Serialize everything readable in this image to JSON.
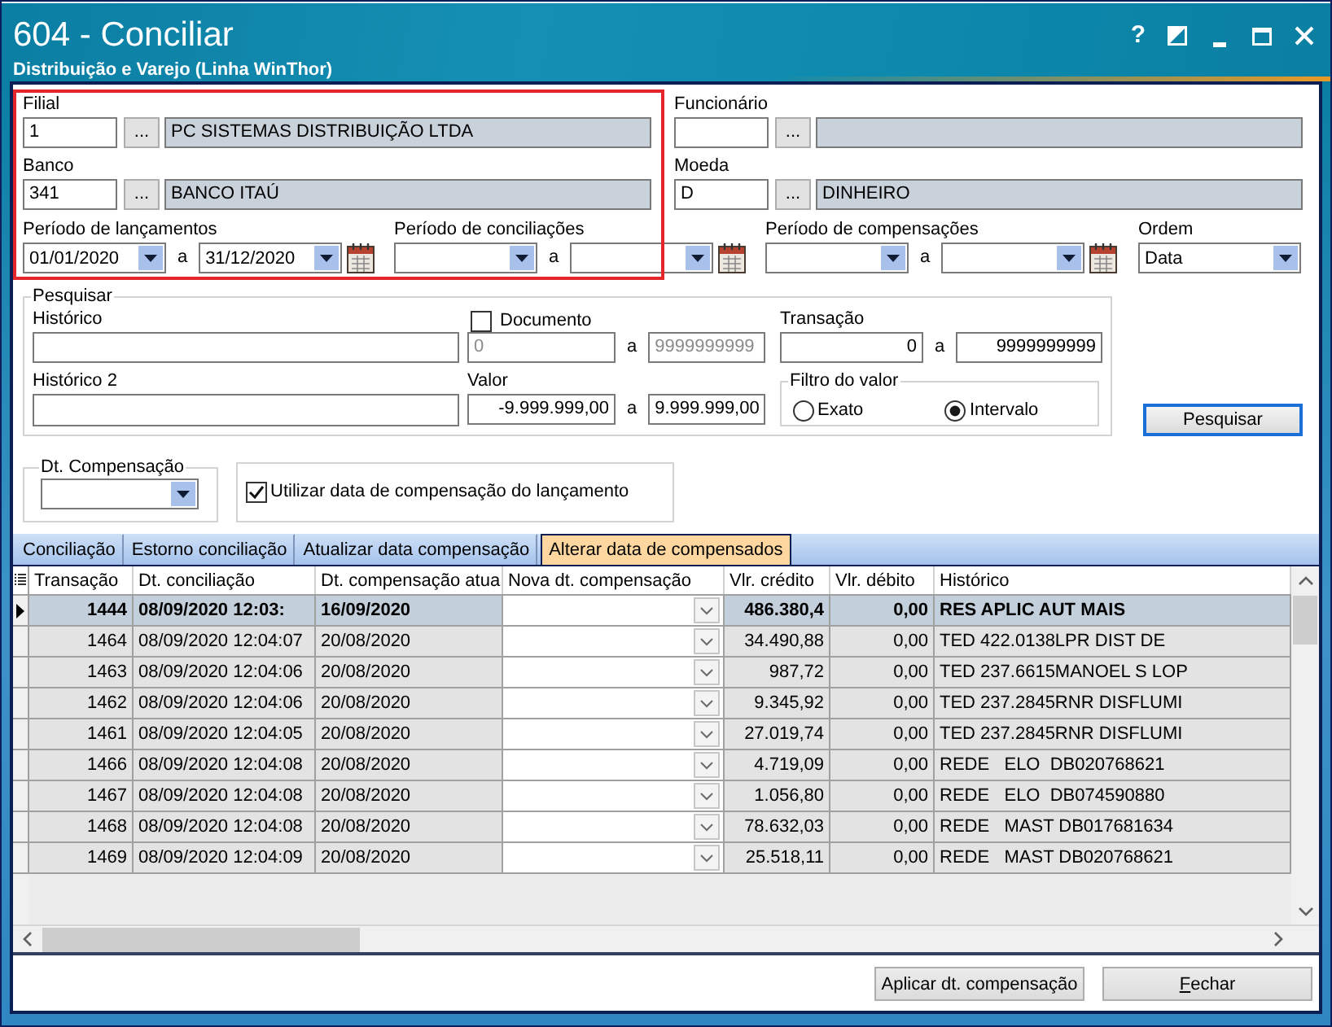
{
  "window": {
    "title": "604 - Conciliar",
    "subtitle": "Distribuição e Varejo (Linha WinThor)"
  },
  "title_buttons": [
    {
      "kind": "help",
      "label": "?"
    },
    {
      "kind": "contrast"
    },
    {
      "kind": "minimize"
    },
    {
      "kind": "maximize"
    },
    {
      "kind": "close"
    }
  ],
  "highlight_frame": true,
  "lookups": [
    {
      "label": "Filial",
      "code": "1",
      "button": "...",
      "description": "PC SISTEMAS DISTRIBUIÇÃO LTDA"
    },
    {
      "label": "Funcionário",
      "button": "..."
    },
    {
      "label": "Banco",
      "code": "341",
      "button": "...",
      "description": "BANCO ITAÚ"
    },
    {
      "label": "Moeda",
      "code": "D",
      "button": "...",
      "description": "DINHEIRO"
    }
  ],
  "periods": [
    {
      "label": "Período de lançamentos",
      "from": "01/01/2020",
      "separator": "a",
      "to": "31/12/2020"
    },
    {
      "label": "Período de conciliações",
      "separator": "a"
    },
    {
      "label": "Período de compensações",
      "separator": "a"
    }
  ],
  "order": {
    "label": "Ordem",
    "value": "Data"
  },
  "search": {
    "title": "Pesquisar",
    "historico": {
      "label": "Histórico"
    },
    "documento": {
      "label": "Documento",
      "checked": false,
      "disabled": true,
      "from": "0",
      "separator": "a",
      "to": "9999999999"
    },
    "transacao": {
      "label": "Transação",
      "from": "0",
      "separator": "a",
      "to": "9999999999"
    },
    "historico2": {
      "label": "Histórico 2"
    },
    "valor": {
      "label": "Valor",
      "from": "-9.999.999,00",
      "separator": "a",
      "to": "9.999.999,00"
    },
    "filtro": {
      "title": "Filtro do valor",
      "options": [
        {
          "label": "Exato",
          "selected": false
        },
        {
          "label": "Intervalo",
          "selected": true
        }
      ]
    },
    "button": {
      "label": "Pesquisar",
      "focused": true
    }
  },
  "compensation": {
    "title": "Dt. Compensação"
  },
  "use_launch_date": {
    "label": "Utilizar data de compensação do lançamento",
    "checked": true
  },
  "tabs": [
    {
      "label": "Conciliação",
      "selected": false
    },
    {
      "label": "Estorno conciliação",
      "selected": false
    },
    {
      "label": "Atualizar data compensação",
      "selected": false
    },
    {
      "label": "Alterar data de compensados",
      "selected": true
    }
  ],
  "table": {
    "columns": [
      {
        "label": "Transação",
        "kind": "number"
      },
      {
        "label": "Dt. conciliação",
        "kind": "text"
      },
      {
        "label": "Dt. compensação atua",
        "kind": "text"
      },
      {
        "label": "Nova dt. compensação",
        "kind": "combo"
      },
      {
        "label": "Vlr. crédito",
        "kind": "number"
      },
      {
        "label": "Vlr. débito",
        "kind": "number"
      },
      {
        "label": "Histórico",
        "kind": "text"
      }
    ],
    "rows": [
      {
        "cells": [
          "1444",
          "08/09/2020 12:03:",
          "16/09/2020",
          "",
          "486.380,4",
          "0,00",
          "RES APLIC AUT MAIS"
        ],
        "selected": true
      },
      {
        "cells": [
          "1464",
          "08/09/2020 12:04:07",
          "20/08/2020",
          "",
          "34.490,88",
          "0,00",
          "TED 422.0138LPR DIST DE"
        ],
        "selected": false
      },
      {
        "cells": [
          "1463",
          "08/09/2020 12:04:06",
          "20/08/2020",
          "",
          "987,72",
          "0,00",
          "TED 237.6615MANOEL S LOP"
        ],
        "selected": false
      },
      {
        "cells": [
          "1462",
          "08/09/2020 12:04:06",
          "20/08/2020",
          "",
          "9.345,92",
          "0,00",
          "TED 237.2845RNR DISFLUMI"
        ],
        "selected": false
      },
      {
        "cells": [
          "1461",
          "08/09/2020 12:04:05",
          "20/08/2020",
          "",
          "27.019,74",
          "0,00",
          "TED 237.2845RNR DISFLUMI"
        ],
        "selected": false
      },
      {
        "cells": [
          "1466",
          "08/09/2020 12:04:08",
          "20/08/2020",
          "",
          "4.719,09",
          "0,00",
          "REDE   ELO  DB020768621"
        ],
        "selected": false
      },
      {
        "cells": [
          "1467",
          "08/09/2020 12:04:08",
          "20/08/2020",
          "",
          "1.056,80",
          "0,00",
          "REDE   ELO  DB074590880"
        ],
        "selected": false
      },
      {
        "cells": [
          "1468",
          "08/09/2020 12:04:08",
          "20/08/2020",
          "",
          "78.632,03",
          "0,00",
          "REDE   MAST DB017681634"
        ],
        "selected": false
      },
      {
        "cells": [
          "1469",
          "08/09/2020 12:04:09",
          "20/08/2020",
          "",
          "25.518,11",
          "0,00",
          "REDE   MAST DB020768621"
        ],
        "selected": false
      }
    ]
  },
  "buttons": [
    {
      "label": "Aplicar dt. compensação",
      "underline_first": false
    },
    {
      "label": "Fechar",
      "underline_first": true
    }
  ]
}
